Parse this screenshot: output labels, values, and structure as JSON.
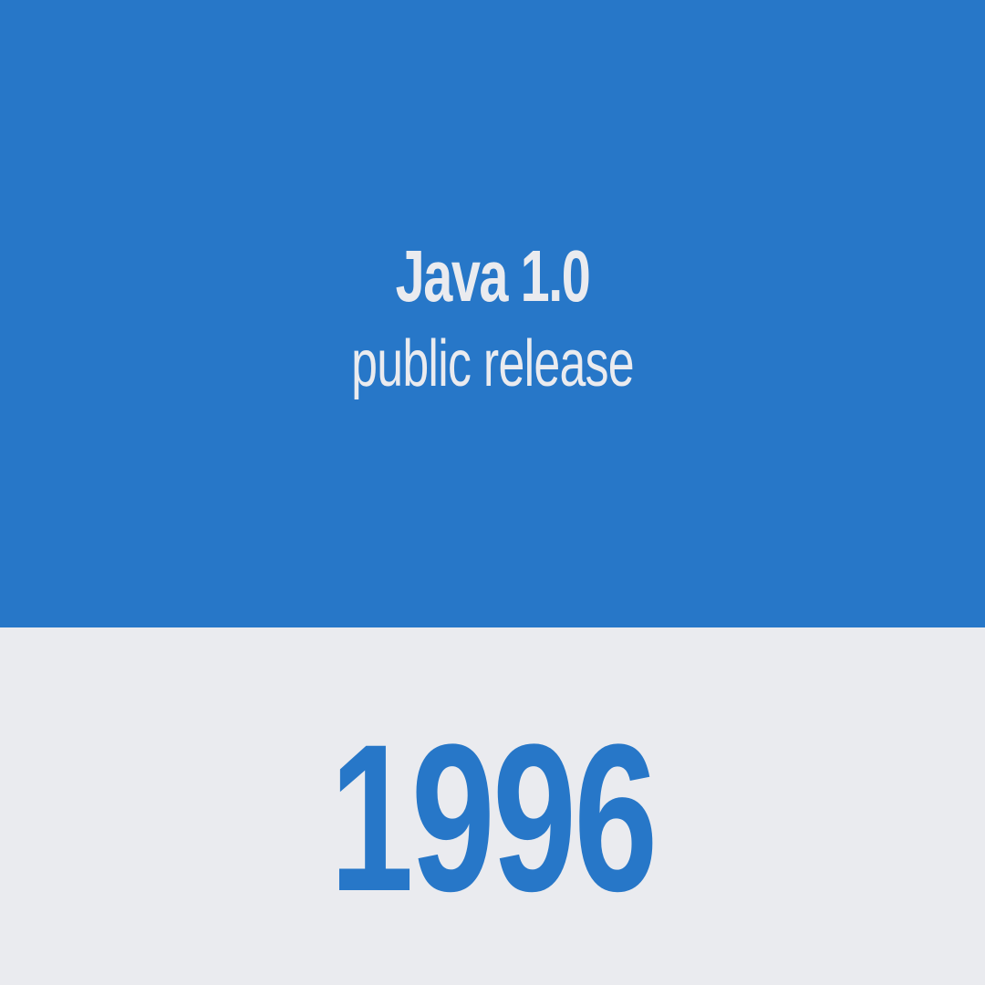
{
  "card": {
    "title": "Java 1.0",
    "subtitle": "public release",
    "year": "1996"
  },
  "colors": {
    "accent": "#2777C8",
    "background": "#EAEBEF",
    "text_on_accent": "#EAEBEF"
  }
}
